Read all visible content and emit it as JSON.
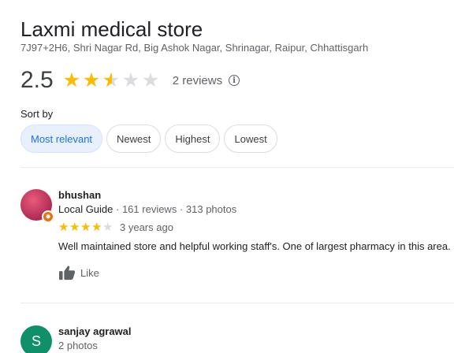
{
  "place": {
    "name": "Laxmi medical store",
    "address": "7J97+2H6, Shri Nagar Rd, Big Ashok Nagar, Shrinagar, Raipur, Chhattisgarh",
    "rating": "2.5",
    "rating_fraction": 0.5,
    "review_count": "2 reviews"
  },
  "sort": {
    "label": "Sort by",
    "options": [
      "Most relevant",
      "Newest",
      "Highest",
      "Lowest"
    ],
    "selected": "Most relevant"
  },
  "reviews": [
    {
      "author": "bhushan",
      "badge": "Local Guide",
      "sep1": " · ",
      "reviews_count": "161 reviews",
      "sep2": " · ",
      "photos_count": "313 photos",
      "stars": 4,
      "time": "3 years ago",
      "text": "Well maintained store and helpful working staff's. One of largest pharmacy in this area.",
      "like_label": "Like"
    },
    {
      "author": "sanjay agrawal",
      "avatar_letter": "S",
      "photos_count": "2 photos"
    }
  ],
  "colors": {
    "star": "#fbbc04",
    "star_empty": "#dadce0",
    "chip_active_bg": "#e8f0fe",
    "chip_active_text": "#1a73e8",
    "avatar_2": "#0f8f6a"
  }
}
